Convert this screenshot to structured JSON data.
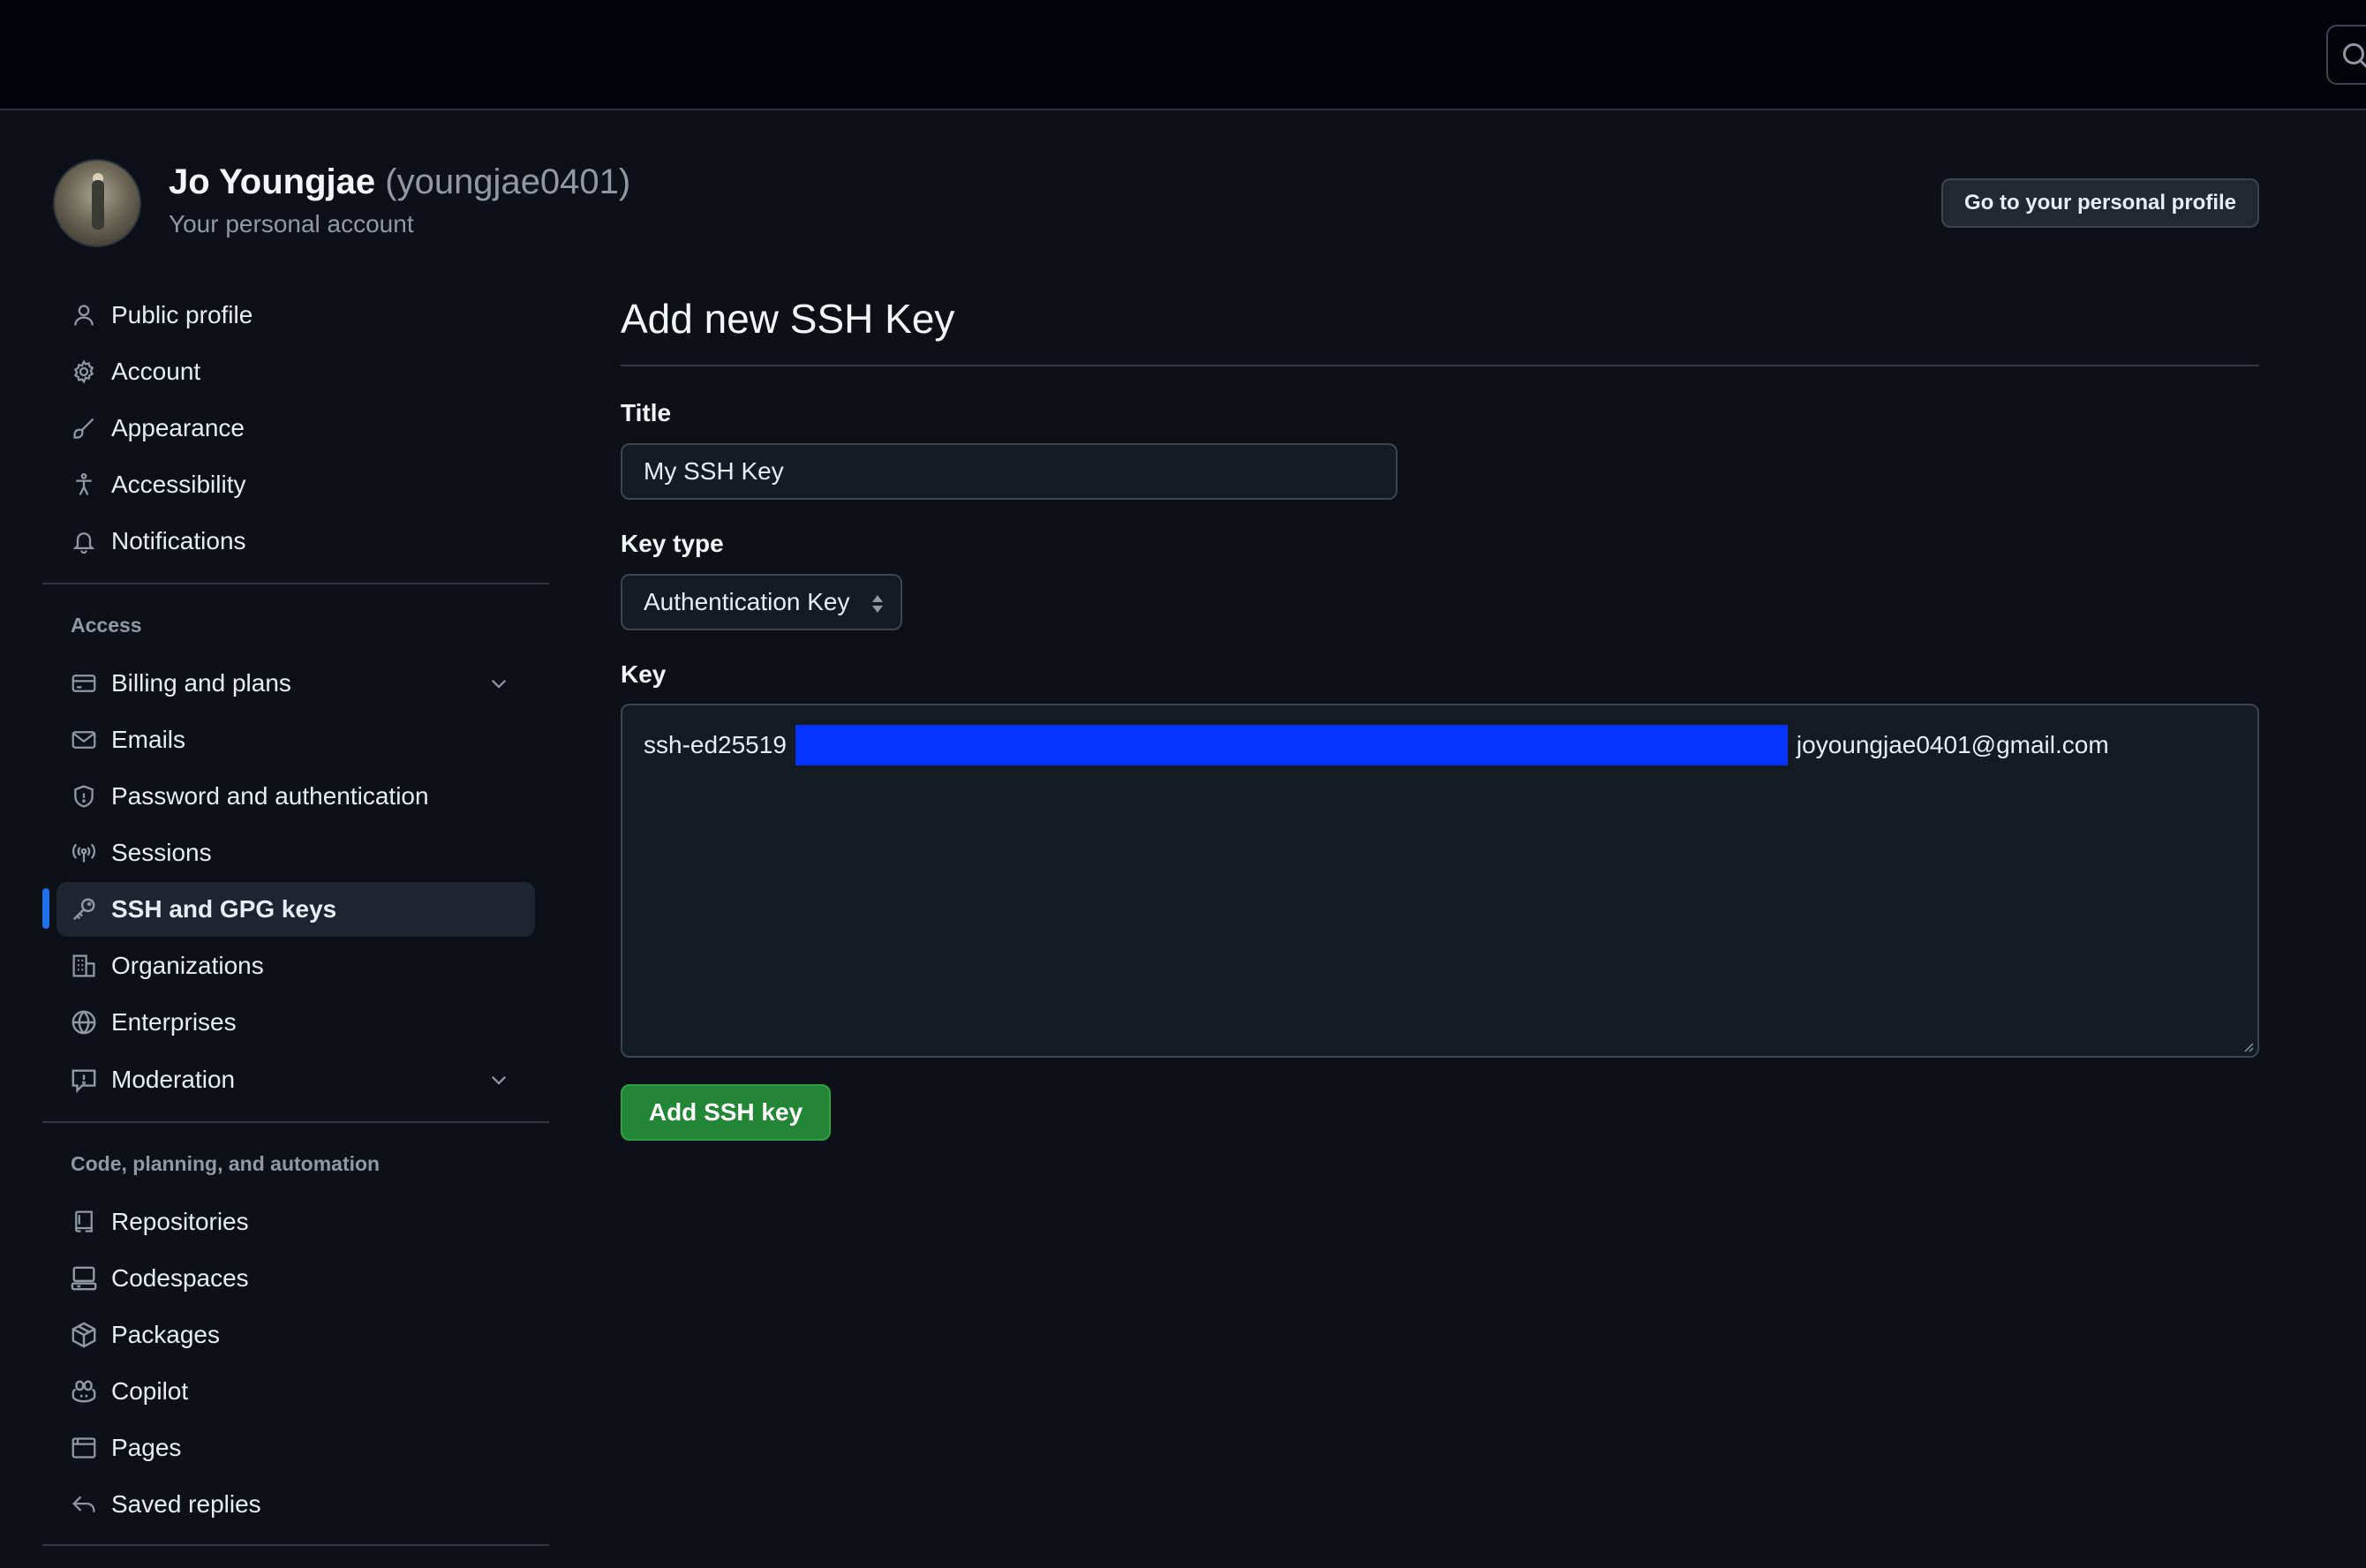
{
  "profile": {
    "name": "Jo Youngjae",
    "handle": "(youngjae0401)",
    "subtitle": "Your personal account",
    "go_profile_label": "Go to your personal profile"
  },
  "sidebar": {
    "items_top": [
      {
        "label": "Public profile",
        "icon": "person-icon"
      },
      {
        "label": "Account",
        "icon": "gear-icon"
      },
      {
        "label": "Appearance",
        "icon": "paintbrush-icon"
      },
      {
        "label": "Accessibility",
        "icon": "accessibility-icon"
      },
      {
        "label": "Notifications",
        "icon": "bell-icon"
      }
    ],
    "access_label": "Access",
    "items_access": [
      {
        "label": "Billing and plans",
        "icon": "credit-card-icon"
      },
      {
        "label": "Emails",
        "icon": "mail-icon"
      },
      {
        "label": "Password and authentication",
        "icon": "shield-icon"
      },
      {
        "label": "Sessions",
        "icon": "broadcast-icon"
      },
      {
        "label": "SSH and GPG keys",
        "icon": "key-icon",
        "active": true
      },
      {
        "label": "Organizations",
        "icon": "organization-icon"
      },
      {
        "label": "Enterprises",
        "icon": "globe-icon"
      },
      {
        "label": "Moderation",
        "icon": "report-icon"
      }
    ],
    "code_label": "Code, planning, and automation",
    "items_code": [
      {
        "label": "Repositories",
        "icon": "repo-icon"
      },
      {
        "label": "Codespaces",
        "icon": "codespaces-icon"
      },
      {
        "label": "Packages",
        "icon": "package-icon"
      },
      {
        "label": "Copilot",
        "icon": "copilot-icon"
      },
      {
        "label": "Pages",
        "icon": "browser-icon"
      },
      {
        "label": "Saved replies",
        "icon": "reply-icon"
      }
    ]
  },
  "form": {
    "heading": "Add new SSH Key",
    "title_label": "Title",
    "title_value": "My SSH Key",
    "key_type_label": "Key type",
    "key_type_value": "Authentication Key",
    "key_label": "Key",
    "key_prefix": "ssh-ed25519",
    "key_suffix": "joyoungjae0401@gmail.com",
    "submit_label": "Add SSH key"
  },
  "colors": {
    "background": "#0d1117",
    "topbar": "#010409",
    "accent": "#1f6feb",
    "primary_button": "#238636",
    "redaction": "#0433ff"
  }
}
